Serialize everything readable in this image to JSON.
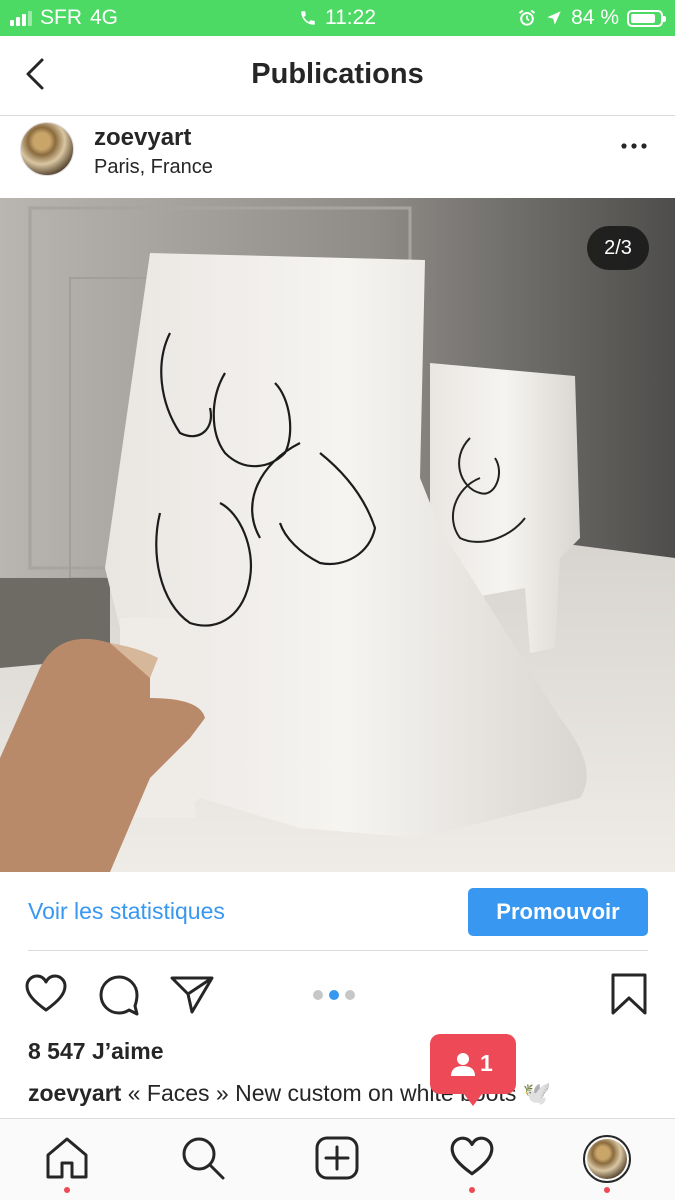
{
  "status_bar": {
    "carrier": "SFR",
    "network": "4G",
    "time": "11:22",
    "battery_percent": "84 %",
    "battery_level": 0.84,
    "signal_bars": 3,
    "background": "#4cd964"
  },
  "nav": {
    "title": "Publications",
    "back_icon": "chevron-left-icon"
  },
  "post": {
    "username": "zoevyart",
    "location": "Paris, France",
    "image_counter": "2/3",
    "image_description_icon": "photo",
    "stats_link": "Voir les statistiques",
    "promote_label": "Promouvoir",
    "likes": "8 547 J’aime",
    "caption_user": "zoevyart",
    "caption_text": "« Faces » New custom on white boots 🕊️",
    "carousel_total": 3,
    "carousel_active": 2
  },
  "notification": {
    "count": "1",
    "icon": "person-icon",
    "color": "#ed4956"
  },
  "tab_bar": {
    "items": [
      "home-icon",
      "search-icon",
      "add-icon",
      "heart-icon",
      "profile-avatar"
    ]
  },
  "colors": {
    "accent": "#3897f0",
    "alert": "#ed4956",
    "text": "#262626"
  }
}
